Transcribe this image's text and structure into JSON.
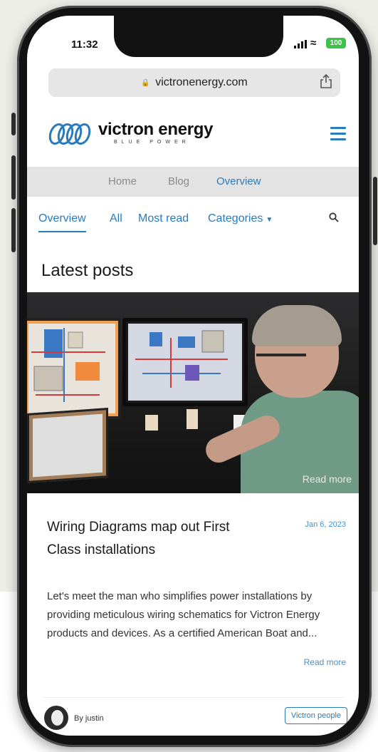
{
  "status_bar": {
    "time": "11:32",
    "battery": "100"
  },
  "browser": {
    "url": "victronenergy.com"
  },
  "site": {
    "brand_name": "victron energy",
    "brand_tagline": "BLUE POWER"
  },
  "breadcrumb": [
    "Home",
    "Blog",
    "Overview"
  ],
  "subnav": {
    "items": [
      "Overview",
      "All",
      "Most read",
      "Categories"
    ],
    "active": "Overview"
  },
  "section": {
    "title": "Latest posts"
  },
  "post": {
    "image_overlay": "Read more",
    "title": "Wiring Diagrams map out First Class installations",
    "date": "Jan 6, 2023",
    "excerpt": "Let's meet the man who simplifies power installations by providing meticulous wiring schematics for Victron Energy products and devices. As a certified American Boat and...",
    "read_more": "Read more",
    "author": "By justin",
    "tag": "Victron people"
  },
  "colors": {
    "accent": "#2a7bbd",
    "battery": "#3ec04a"
  },
  "icons": [
    "lock-icon",
    "share-icon",
    "menu-icon",
    "search-icon",
    "chevron-down-icon",
    "wifi-icon",
    "signal-icon",
    "battery-icon"
  ]
}
